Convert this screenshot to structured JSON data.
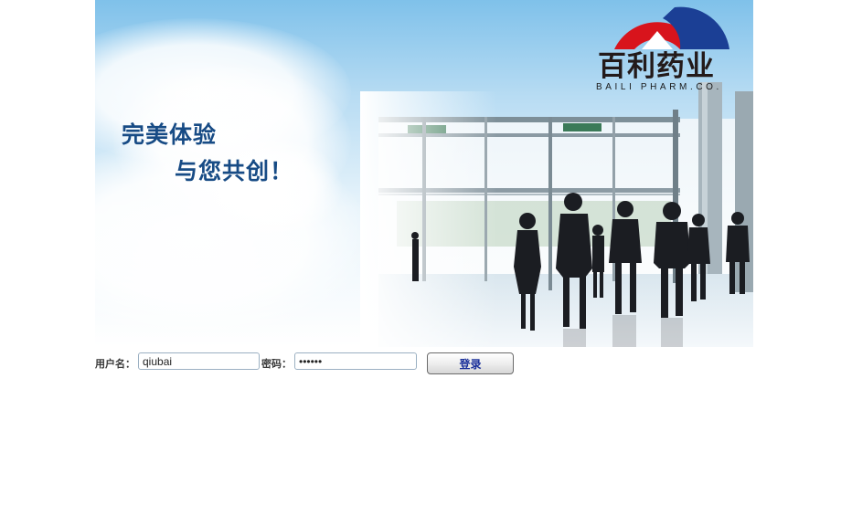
{
  "banner": {
    "slogan_line1": "完美体验",
    "slogan_line2": "与您共创！",
    "logo": {
      "name_cn": "百利药业",
      "name_en": "BAILI PHARM.CO.",
      "colors": {
        "red": "#d8141c",
        "blue": "#1b3f95"
      }
    },
    "scene_icon": "airport-terminal-people-photo"
  },
  "login": {
    "username_label": "用户名：",
    "username_value": "qiubai",
    "password_label": "密码：",
    "password_value": "••••••",
    "submit_label": "登录"
  },
  "colors": {
    "slogan": "#174b85",
    "button_text": "#1a2f9a",
    "label_text": "#3a3a3a"
  }
}
